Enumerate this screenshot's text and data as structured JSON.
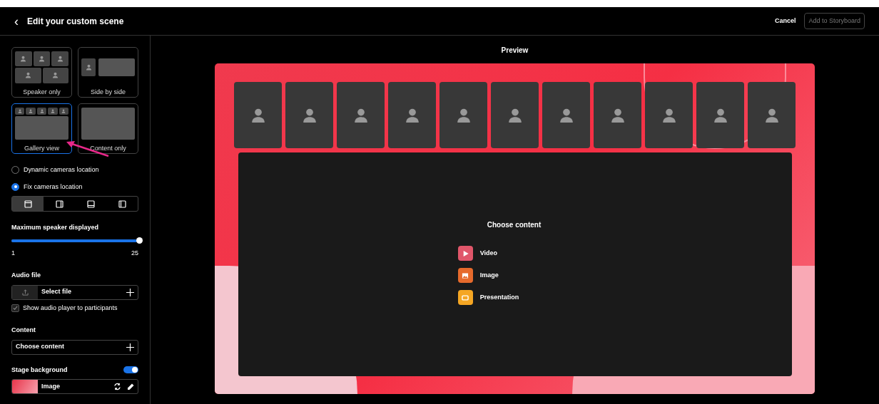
{
  "header": {
    "title": "Edit your custom scene",
    "back": "‹",
    "cancel": "Cancel",
    "add": "Add to Storyboard"
  },
  "layouts": [
    {
      "kind": "speaker",
      "label": "Speaker only",
      "selected": false
    },
    {
      "kind": "side",
      "label": "Side by side",
      "selected": false
    },
    {
      "kind": "gallery",
      "label": "Gallery view",
      "selected": true
    },
    {
      "kind": "content",
      "label": "Content only",
      "selected": false
    }
  ],
  "camera_modes": [
    {
      "label": "Dynamic cameras location",
      "selected": false
    },
    {
      "label": "Fix cameras location",
      "selected": true
    }
  ],
  "positions": [
    {
      "kind": "top",
      "selected": true
    },
    {
      "kind": "right",
      "selected": false
    },
    {
      "kind": "bottom",
      "selected": false
    },
    {
      "kind": "left",
      "selected": false
    }
  ],
  "max_speakers": {
    "label": "Maximum speaker displayed",
    "level": 1,
    "min": "1",
    "max": "25"
  },
  "audio": {
    "label": "Audio file",
    "button": "Select file",
    "show_player": {
      "label": "Show audio player to participants",
      "checked": true
    }
  },
  "content": {
    "label": "Content",
    "button": "Choose content"
  },
  "stage_background": {
    "label": "Stage background",
    "on": true,
    "value": "Image"
  },
  "preview": {
    "title": "Preview",
    "participants": [
      {
        "kind": "avatar"
      },
      {
        "kind": "avatar"
      },
      {
        "kind": "avatar"
      },
      {
        "kind": "avatar"
      },
      {
        "kind": "avatar"
      },
      {
        "kind": "avatar"
      },
      {
        "kind": "avatar"
      },
      {
        "kind": "avatar"
      },
      {
        "kind": "avatar"
      },
      {
        "kind": "avatar"
      },
      {
        "kind": "avatar"
      }
    ],
    "content_title": "Choose content",
    "options": [
      {
        "kind": "video",
        "label": "Video",
        "color": "#e0566a"
      },
      {
        "kind": "image",
        "label": "Image",
        "color": "#e66a2c"
      },
      {
        "kind": "presentation",
        "label": "Presentation",
        "color": "#f5a623"
      }
    ]
  }
}
